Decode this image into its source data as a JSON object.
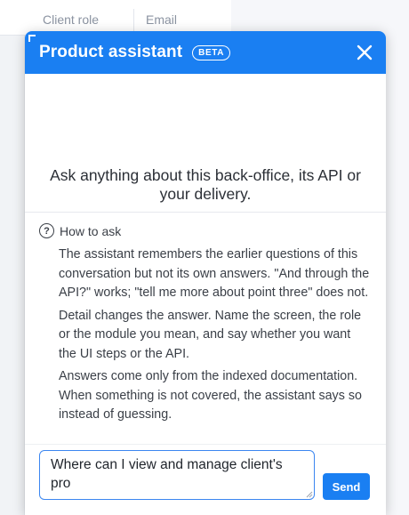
{
  "background": {
    "columns": [
      "Client role",
      "Email"
    ]
  },
  "assistant": {
    "title": "Product assistant",
    "badge": "BETA",
    "close_icon": "close-icon",
    "intro": "Ask anything about this back-office, its API or your delivery.",
    "help": {
      "icon": "question-circle-icon",
      "title": "How to ask",
      "paragraphs": [
        "The assistant remembers the earlier questions of this conversation but not its own answers. \"And through the API?\" works; \"tell me more about point three\" does not.",
        "Detail changes the answer. Name the screen, the role or the module you mean, and say whether you want the UI steps or the API.",
        "Answers come only from the indexed documentation. When something is not covered, the assistant says so instead of guessing."
      ]
    },
    "composer": {
      "value": "Where can I view and manage client's pro",
      "send_label": "Send"
    }
  },
  "colors": {
    "accent": "#1a7ff2",
    "text": "#3a3f47"
  }
}
